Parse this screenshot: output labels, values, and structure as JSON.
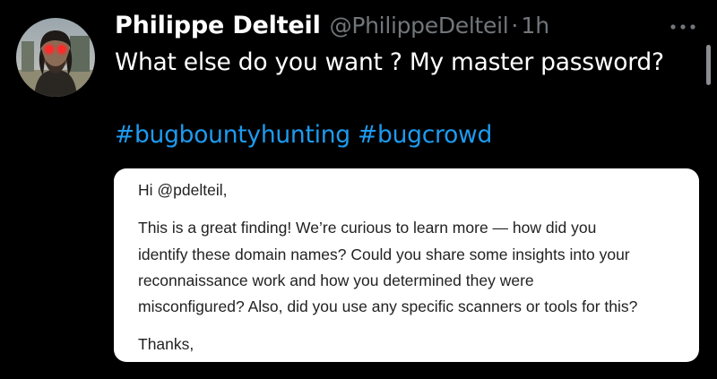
{
  "tweet": {
    "author": {
      "display_name": "Philippe Delteil",
      "handle": "@PhilippeDelteil",
      "separator": "·",
      "time": "1h"
    },
    "text": "What else do you want ? My master password?",
    "hashtags": [
      "#bugbountyhunting",
      "#bugcrowd"
    ],
    "more_icon": "more-horizontal-icon",
    "avatar_icon": "profile-avatar"
  },
  "email": {
    "greeting": "Hi @pdelteil,",
    "body_lines": [
      "This is a great finding! We’re curious to learn more — how did you",
      "identify these domain names? Could you share some insights into your",
      "reconnaissance work and how you determined they were",
      "misconfigured? Also, did you use any specific scanners or tools for this?"
    ],
    "signoff": "Thanks,"
  },
  "colors": {
    "background": "#000000",
    "primary_text": "#ffffff",
    "secondary_text": "#71767b",
    "hashtag": "#1d9bf0",
    "card_background": "#ffffff",
    "card_text": "#222222"
  }
}
